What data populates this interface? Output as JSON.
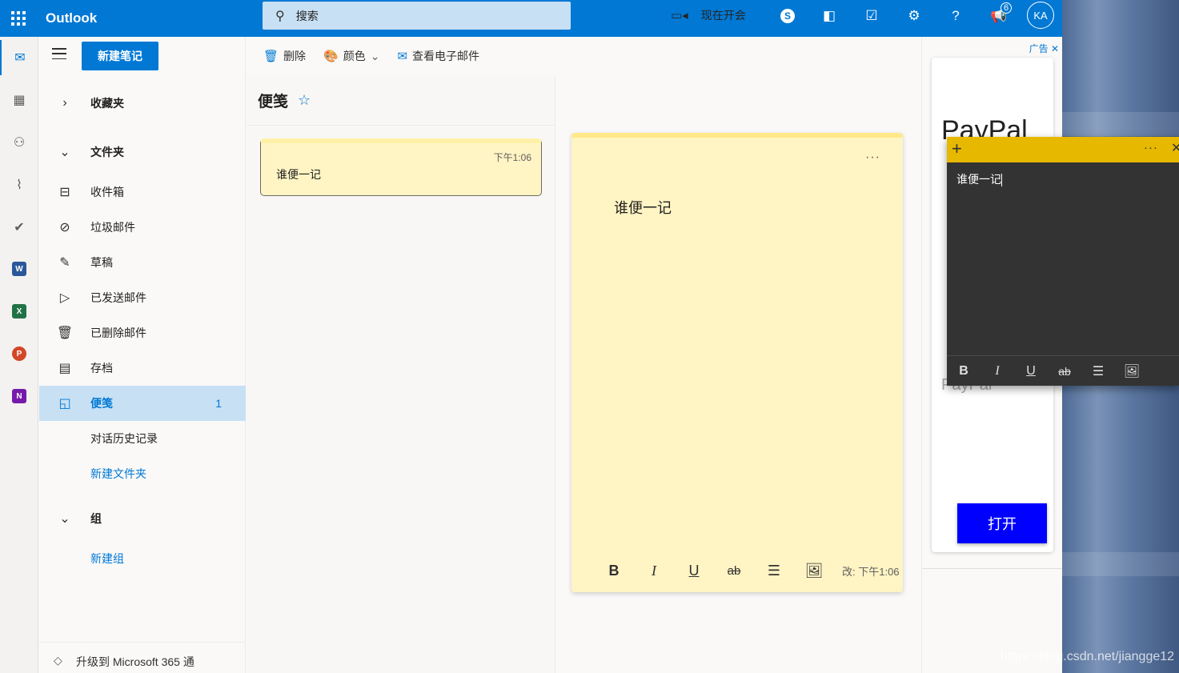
{
  "topbar": {
    "app_name": "Outlook",
    "search_placeholder": "搜索",
    "meet_now": "现在开会",
    "notification_count": "6",
    "avatar_initials": "KA"
  },
  "nav": {
    "new_note": "新建笔记",
    "favorites": "收藏夹",
    "folders": "文件夹",
    "items": [
      {
        "label": "收件箱"
      },
      {
        "label": "垃圾邮件"
      },
      {
        "label": "草稿"
      },
      {
        "label": "已发送邮件"
      },
      {
        "label": "已删除邮件"
      },
      {
        "label": "存档"
      },
      {
        "label": "便笺",
        "count": "1"
      },
      {
        "label": "对话历史记录"
      },
      {
        "label": "新建文件夹"
      }
    ],
    "groups": "组",
    "new_group": "新建组",
    "upgrade": "升级到 Microsoft 365 通"
  },
  "commands": {
    "delete": "删除",
    "color": "颜色",
    "view_email": "查看电子邮件"
  },
  "list": {
    "title": "便笺",
    "note": {
      "time": "下午1:06",
      "text": "谁便一记"
    }
  },
  "editor": {
    "more": "···",
    "text": "谁便一记",
    "modified": "改: 下午1:06"
  },
  "ad": {
    "label": "广告",
    "brand": "PayPal",
    "brand_faded": "PayPal",
    "open": "打开"
  },
  "sticky": {
    "text": "谁便一记"
  },
  "watermark": "https://blog.csdn.net/jiangge12",
  "colors": {
    "brand": "#0078d4",
    "note_yellow": "#fff4c4",
    "sticky_bar": "#e6b800",
    "sticky_body": "#333333",
    "ad_button": "#0000ff"
  }
}
